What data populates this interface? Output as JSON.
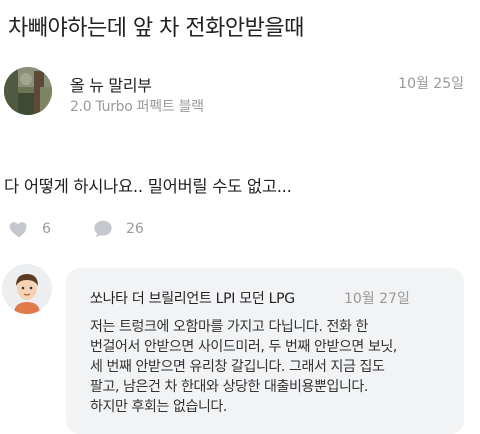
{
  "post": {
    "title": "차빼야하는데 앞 차 전화안받을때",
    "author_name": "올 뉴 말리부",
    "author_car": "2.0 Turbo 퍼펙트 블랙",
    "date": "10월 25일",
    "body": "다 어떻게 하시나요.. 밀어버릴 수도 없고...",
    "likes": "6",
    "comments": "26"
  },
  "comment": {
    "author": "쏘나타 더 브릴리언트 LPI 모던 LPG",
    "date": "10월 27일",
    "lines": [
      "저는 트렁크에 오함마를 가지고 다닙니다. 전화 한",
      "번걸어서 안받으면 사이드미러, 두 번째 안받으면 보닛,",
      "세 번째 안받으면 유리창 갈깁니다. 그래서 지금 집도",
      "팔고, 남은건 차 한대와 상당한 대출비용뿐입니다.",
      "하지만 후회는 없습니다."
    ]
  },
  "icons": {
    "like": "heart-icon",
    "comment": "speech-bubble-icon"
  },
  "colors": {
    "muted_text": "#9a9a9a",
    "comment_bg": "#f1f3f5",
    "icon_gray": "#c4c8cc"
  }
}
